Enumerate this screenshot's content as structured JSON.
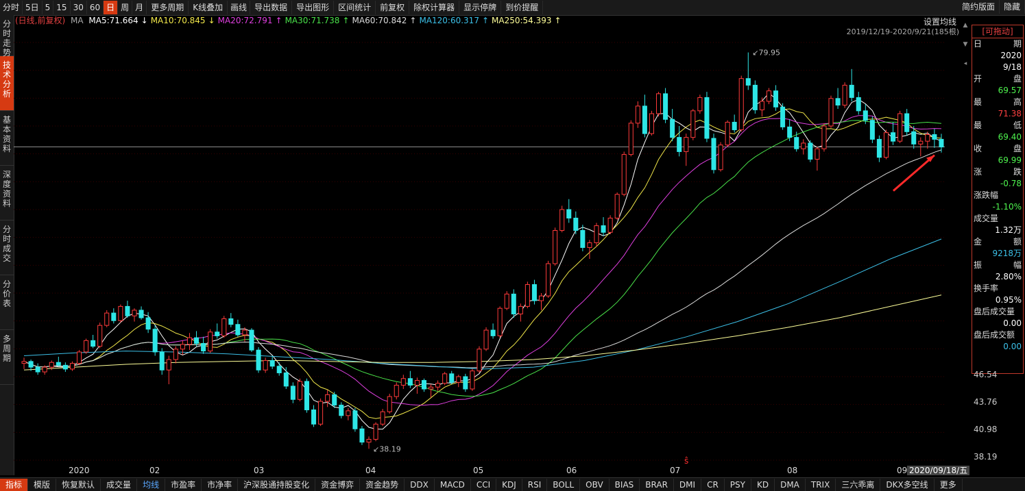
{
  "toolbar": {
    "items": [
      "分时",
      "5日",
      "5",
      "15",
      "30",
      "60",
      "日",
      "周",
      "月",
      "更多周期",
      "K线叠加",
      "画线",
      "导出数据",
      "导出图形",
      "区间统计",
      "前复权",
      "除权计算器",
      "显示停牌",
      "到价提醒"
    ],
    "active_index": 6,
    "right_items": [
      "简约版面",
      "隐藏"
    ]
  },
  "side_tabs": [
    {
      "label": "分时走势",
      "active": false
    },
    {
      "label": "技术分析",
      "active": true
    },
    {
      "label": "基本资料",
      "active": false
    },
    {
      "label": "深度资料",
      "active": false
    },
    {
      "label": "分时成交",
      "active": false
    },
    {
      "label": "分价表",
      "active": false
    },
    {
      "label": "多周期",
      "active": false
    }
  ],
  "ma_legend": {
    "prefix": "(日线,前复权)",
    "ma": "MA",
    "items": [
      {
        "text": "MA5:71.664",
        "arrow": "↓",
        "color": "#ffffff"
      },
      {
        "text": "MA10:70.845",
        "arrow": "↓",
        "color": "#f2e84a"
      },
      {
        "text": "MA20:72.791",
        "arrow": "↑",
        "color": "#e040e0"
      },
      {
        "text": "MA30:71.738",
        "arrow": "↑",
        "color": "#4ae34a"
      },
      {
        "text": "MA60:70.842",
        "arrow": "↑",
        "color": "#dddddd"
      },
      {
        "text": "MA120:60.317",
        "arrow": "↑",
        "color": "#3cc0e8"
      },
      {
        "text": "MA250:54.393",
        "arrow": "↑",
        "color": "#ffff99"
      }
    ]
  },
  "set_ma": "设置均线",
  "range_label": "2019/12/19-2020/9/21(185根)",
  "annotations": {
    "high_label": "79.95",
    "low_label": "38.19"
  },
  "yaxis": {
    "labels": [
      "46.54",
      "43.76",
      "40.98",
      "38.19"
    ]
  },
  "xaxis": {
    "labels": [
      "2020",
      "02",
      "03",
      "04",
      "05",
      "06",
      "07",
      "08",
      "09"
    ],
    "cursor_date": "2020/09/18/五"
  },
  "info_panel": {
    "title": "[可拖动]",
    "date_label": [
      "日",
      "期"
    ],
    "year": "2020",
    "date": "9/18",
    "open_label": [
      "开",
      "盘"
    ],
    "open": "69.57",
    "high_label": [
      "最",
      "高"
    ],
    "high": "71.38",
    "low_label": [
      "最",
      "低"
    ],
    "low": "69.40",
    "close_label": [
      "收",
      "盘"
    ],
    "close": "69.99",
    "change_label": [
      "涨",
      "跌"
    ],
    "change": "-0.78",
    "pct_label": "涨跌幅",
    "pct": "-1.10%",
    "vol_label": "成交量",
    "vol": "1.32万",
    "amount_label": [
      "金",
      "额"
    ],
    "amount": "9218万",
    "amp_label": [
      "振",
      "幅"
    ],
    "amp": "2.80%",
    "turnover_label": "换手率",
    "turnover": "0.95%",
    "after_vol_label": "盘后成交量",
    "after_vol": "0.00",
    "after_amt_label": "盘后成交额",
    "after_amt": "0.00"
  },
  "bottom_tabs": [
    "指标",
    "模版",
    "恢复默认",
    "成交量",
    "均线",
    "市盈率",
    "市净率",
    "沪深股通持股变化",
    "资金博弈",
    "资金趋势",
    "DDX",
    "MACD",
    "CCI",
    "KDJ",
    "RSI",
    "BOLL",
    "OBV",
    "BIAS",
    "BRAR",
    "DMI",
    "CR",
    "PSY",
    "KD",
    "DMA",
    "TRIX",
    "三六乖离",
    "DKX多空线",
    "更多"
  ],
  "bottom_active": 0,
  "bottom_blue": 4,
  "colors": {
    "up": "#ff3b3b",
    "down": "#2ee6e6",
    "accent": "#d63a12"
  },
  "chart_data": {
    "type": "candlestick",
    "y_range": [
      37.0,
      81.0
    ],
    "candles": [
      [
        47.2,
        47.8,
        46.6,
        47.4
      ],
      [
        47.4,
        47.6,
        46.4,
        46.8
      ],
      [
        46.8,
        47.2,
        46.0,
        46.3
      ],
      [
        46.3,
        47.0,
        46.0,
        46.8
      ],
      [
        46.8,
        47.5,
        46.5,
        47.3
      ],
      [
        47.3,
        47.9,
        46.9,
        47.0
      ],
      [
        47.0,
        47.3,
        46.3,
        46.6
      ],
      [
        46.6,
        47.4,
        46.4,
        47.2
      ],
      [
        47.2,
        48.6,
        47.0,
        48.4
      ],
      [
        48.4,
        49.8,
        48.2,
        49.6
      ],
      [
        49.6,
        50.2,
        48.8,
        49.0
      ],
      [
        49.0,
        51.5,
        48.8,
        51.2
      ],
      [
        51.2,
        52.8,
        51.0,
        52.5
      ],
      [
        52.5,
        53.0,
        51.4,
        51.7
      ],
      [
        51.7,
        53.4,
        51.5,
        53.2
      ],
      [
        53.2,
        53.8,
        52.0,
        52.2
      ],
      [
        52.2,
        53.0,
        51.6,
        52.8
      ],
      [
        52.8,
        53.2,
        51.8,
        52.0
      ],
      [
        52.0,
        52.6,
        50.4,
        50.8
      ],
      [
        50.8,
        51.2,
        48.0,
        48.4
      ],
      [
        48.4,
        48.8,
        46.0,
        46.5
      ],
      [
        46.5,
        48.0,
        45.0,
        47.6
      ],
      [
        47.6,
        49.0,
        47.2,
        48.7
      ],
      [
        48.7,
        49.6,
        48.1,
        49.2
      ],
      [
        49.2,
        50.4,
        48.6,
        49.9
      ],
      [
        49.9,
        50.6,
        49.0,
        49.3
      ],
      [
        49.3,
        50.0,
        48.2,
        48.5
      ],
      [
        48.5,
        50.8,
        48.3,
        50.5
      ],
      [
        50.5,
        51.4,
        49.8,
        50.1
      ],
      [
        50.1,
        52.2,
        49.9,
        51.9
      ],
      [
        51.9,
        52.5,
        51.0,
        51.3
      ],
      [
        51.3,
        51.8,
        50.0,
        50.2
      ],
      [
        50.2,
        51.0,
        49.5,
        50.7
      ],
      [
        50.7,
        50.9,
        48.4,
        48.6
      ],
      [
        48.6,
        48.9,
        46.2,
        46.5
      ],
      [
        46.5,
        47.8,
        46.2,
        47.5
      ],
      [
        47.5,
        48.0,
        46.6,
        46.9
      ],
      [
        46.9,
        47.3,
        45.9,
        46.2
      ],
      [
        46.2,
        46.8,
        44.5,
        44.8
      ],
      [
        44.8,
        45.2,
        43.0,
        43.4
      ],
      [
        43.4,
        45.6,
        43.2,
        45.3
      ],
      [
        45.3,
        45.6,
        42.0,
        42.3
      ],
      [
        42.3,
        42.8,
        40.5,
        40.8
      ],
      [
        40.8,
        43.5,
        40.6,
        43.2
      ],
      [
        43.2,
        44.4,
        42.6,
        43.9
      ],
      [
        43.9,
        44.2,
        42.5,
        42.8
      ],
      [
        42.8,
        43.1,
        41.4,
        41.7
      ],
      [
        41.7,
        42.5,
        41.2,
        42.2
      ],
      [
        42.2,
        42.5,
        40.0,
        40.3
      ],
      [
        40.3,
        40.6,
        38.6,
        38.9
      ],
      [
        38.9,
        39.5,
        38.2,
        39.2
      ],
      [
        39.2,
        41.0,
        39.0,
        40.8
      ],
      [
        40.8,
        42.4,
        40.6,
        42.1
      ],
      [
        42.1,
        44.0,
        41.9,
        43.7
      ],
      [
        43.7,
        45.2,
        43.4,
        44.9
      ],
      [
        44.9,
        46.0,
        44.5,
        45.6
      ],
      [
        45.6,
        46.4,
        44.6,
        44.9
      ],
      [
        44.9,
        45.7,
        44.0,
        45.4
      ],
      [
        45.4,
        45.6,
        44.2,
        44.5
      ],
      [
        44.5,
        45.0,
        43.6,
        44.7
      ],
      [
        44.7,
        45.4,
        44.3,
        45.1
      ],
      [
        45.1,
        46.3,
        44.9,
        46.1
      ],
      [
        46.1,
        46.4,
        45.0,
        45.2
      ],
      [
        45.2,
        46.0,
        44.7,
        45.8
      ],
      [
        45.8,
        46.1,
        44.2,
        44.5
      ],
      [
        44.5,
        46.6,
        44.3,
        46.4
      ],
      [
        46.4,
        49.0,
        46.2,
        48.7
      ],
      [
        48.7,
        51.0,
        48.5,
        50.7
      ],
      [
        50.7,
        51.4,
        49.8,
        50.1
      ],
      [
        50.1,
        53.2,
        49.9,
        53.0
      ],
      [
        53.0,
        54.8,
        52.8,
        54.5
      ],
      [
        54.5,
        55.0,
        52.0,
        52.4
      ],
      [
        52.4,
        53.5,
        51.6,
        53.2
      ],
      [
        53.2,
        55.8,
        53.0,
        55.5
      ],
      [
        55.5,
        56.0,
        53.4,
        53.8
      ],
      [
        53.8,
        54.6,
        52.8,
        54.3
      ],
      [
        54.3,
        58.0,
        54.1,
        57.7
      ],
      [
        57.7,
        61.5,
        57.5,
        61.2
      ],
      [
        61.2,
        63.8,
        61.0,
        63.4
      ],
      [
        63.4,
        64.5,
        62.0,
        62.5
      ],
      [
        62.5,
        63.2,
        60.8,
        61.2
      ],
      [
        61.2,
        61.8,
        59.0,
        59.4
      ],
      [
        59.4,
        60.2,
        58.2,
        59.9
      ],
      [
        59.9,
        62.0,
        59.5,
        61.7
      ],
      [
        61.7,
        62.6,
        60.6,
        61.0
      ],
      [
        61.0,
        62.8,
        60.8,
        62.5
      ],
      [
        62.5,
        65.2,
        62.3,
        65.0
      ],
      [
        65.0,
        69.5,
        64.8,
        69.2
      ],
      [
        69.2,
        72.8,
        69.0,
        72.5
      ],
      [
        72.5,
        74.8,
        72.0,
        74.3
      ],
      [
        74.3,
        75.5,
        71.0,
        71.4
      ],
      [
        71.4,
        73.8,
        71.2,
        73.5
      ],
      [
        73.5,
        75.8,
        73.2,
        75.6
      ],
      [
        75.6,
        76.2,
        72.5,
        72.9
      ],
      [
        72.9,
        74.0,
        70.6,
        71.0
      ],
      [
        71.0,
        72.2,
        69.0,
        69.5
      ],
      [
        69.5,
        71.4,
        68.0,
        71.0
      ],
      [
        71.0,
        74.0,
        70.7,
        73.8
      ],
      [
        73.8,
        75.5,
        73.5,
        75.2
      ],
      [
        75.2,
        75.8,
        70.5,
        70.9
      ],
      [
        70.9,
        71.4,
        67.2,
        67.6
      ],
      [
        67.6,
        70.5,
        67.4,
        70.2
      ],
      [
        70.2,
        72.8,
        70.0,
        72.6
      ],
      [
        72.6,
        73.4,
        71.5,
        71.8
      ],
      [
        71.8,
        77.5,
        71.6,
        77.2
      ],
      [
        77.2,
        79.95,
        76.0,
        76.5
      ],
      [
        76.5,
        77.0,
        73.5,
        73.9
      ],
      [
        73.9,
        75.2,
        73.2,
        74.8
      ],
      [
        74.8,
        76.2,
        74.5,
        75.9
      ],
      [
        75.9,
        76.5,
        73.8,
        74.2
      ],
      [
        74.2,
        74.6,
        71.8,
        72.1
      ],
      [
        72.1,
        72.9,
        70.6,
        71.0
      ],
      [
        71.0,
        71.6,
        69.5,
        69.8
      ],
      [
        69.8,
        70.8,
        69.2,
        70.4
      ],
      [
        70.4,
        70.7,
        68.4,
        68.7
      ],
      [
        68.7,
        70.0,
        67.5,
        69.8
      ],
      [
        69.8,
        72.5,
        69.5,
        72.2
      ],
      [
        72.2,
        75.4,
        72.0,
        75.1
      ],
      [
        75.1,
        76.2,
        74.0,
        74.4
      ],
      [
        74.4,
        76.8,
        74.1,
        76.5
      ],
      [
        76.5,
        78.2,
        74.8,
        75.2
      ],
      [
        75.2,
        75.8,
        73.4,
        73.8
      ],
      [
        73.8,
        74.5,
        72.4,
        72.8
      ],
      [
        72.8,
        73.2,
        70.4,
        70.8
      ],
      [
        70.8,
        71.2,
        68.4,
        68.9
      ],
      [
        68.9,
        71.8,
        68.7,
        71.5
      ],
      [
        71.5,
        72.6,
        70.2,
        70.6
      ],
      [
        70.6,
        73.8,
        70.4,
        73.5
      ],
      [
        73.5,
        74.0,
        71.2,
        71.6
      ],
      [
        71.6,
        72.2,
        69.8,
        70.3
      ],
      [
        70.3,
        71.0,
        69.0,
        70.6
      ],
      [
        70.6,
        71.6,
        69.8,
        71.3
      ],
      [
        71.3,
        71.9,
        69.9,
        70.8
      ],
      [
        70.8,
        71.38,
        69.4,
        69.99
      ]
    ]
  }
}
